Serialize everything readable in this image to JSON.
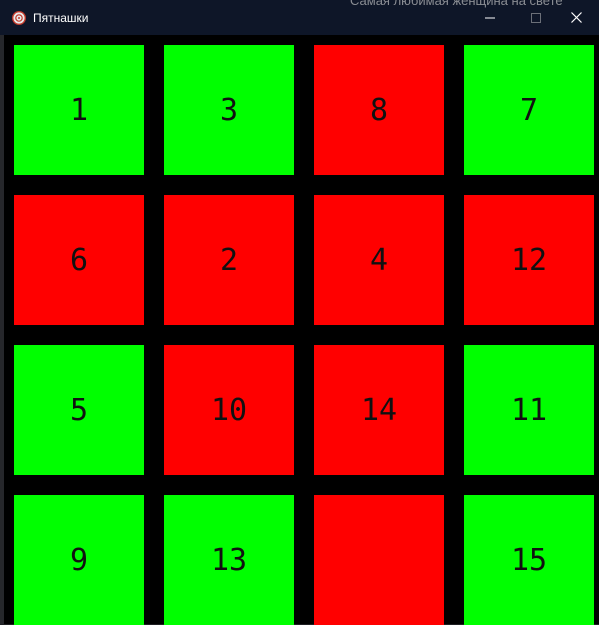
{
  "window": {
    "title": "Пятнашки",
    "background_text": "Самая любимая женщина на свете"
  },
  "colors": {
    "correct": "#00ff00",
    "wrong": "#ff0000",
    "background": "#000000"
  },
  "board": {
    "tiles": [
      {
        "label": "1",
        "state": "correct"
      },
      {
        "label": "3",
        "state": "correct"
      },
      {
        "label": "8",
        "state": "wrong"
      },
      {
        "label": "7",
        "state": "correct"
      },
      {
        "label": "6",
        "state": "wrong"
      },
      {
        "label": "2",
        "state": "wrong"
      },
      {
        "label": "4",
        "state": "wrong"
      },
      {
        "label": "12",
        "state": "wrong"
      },
      {
        "label": "5",
        "state": "correct"
      },
      {
        "label": "10",
        "state": "wrong"
      },
      {
        "label": "14",
        "state": "wrong"
      },
      {
        "label": "11",
        "state": "correct"
      },
      {
        "label": "9",
        "state": "correct"
      },
      {
        "label": "13",
        "state": "correct"
      },
      {
        "label": "",
        "state": "wrong"
      },
      {
        "label": "15",
        "state": "correct"
      }
    ]
  }
}
